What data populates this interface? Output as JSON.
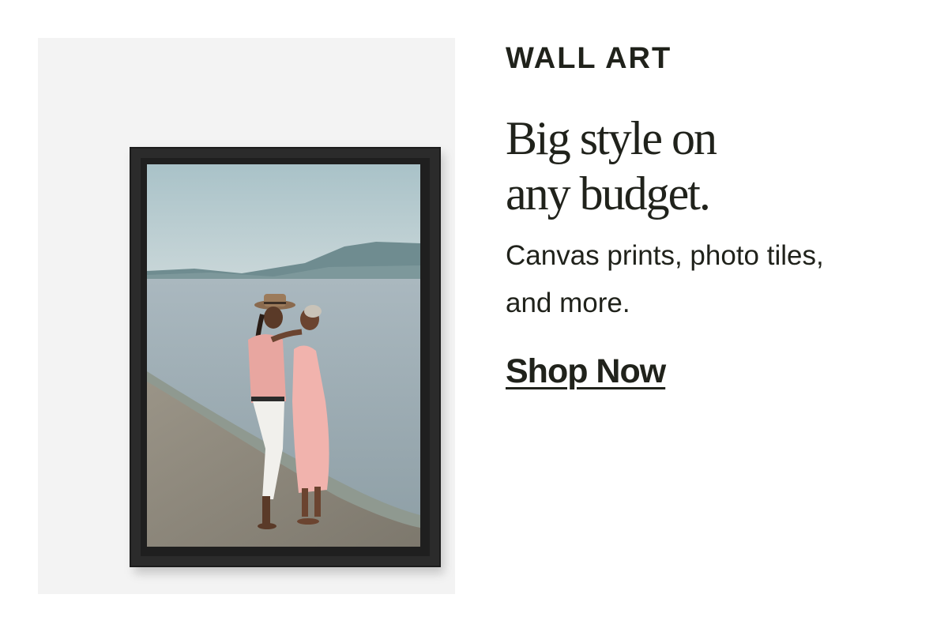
{
  "promo": {
    "eyebrow": "WALL ART",
    "headline_line1": "Big style on",
    "headline_line2": "any budget.",
    "subtext": "Canvas prints, photo tiles, and more.",
    "cta_label": "Shop Now"
  },
  "colors": {
    "text": "#20221b",
    "panel_background": "#f3f3f3",
    "frame": "#2b2b2b"
  }
}
